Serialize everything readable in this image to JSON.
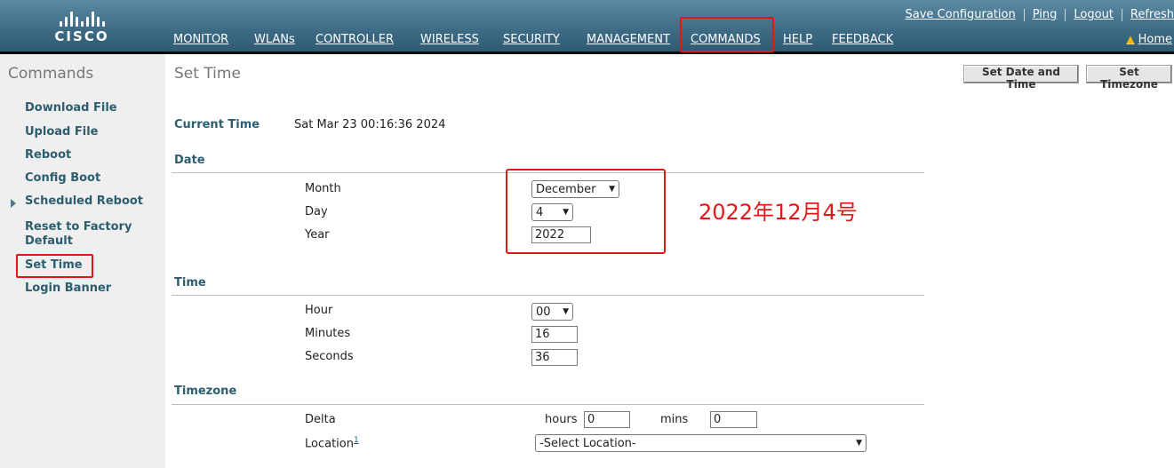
{
  "header": {
    "logo_text": "CISCO",
    "top_links": [
      "Save Configuration",
      "Ping",
      "Logout",
      "Refresh"
    ],
    "nav": [
      "MONITOR",
      "WLANs",
      "CONTROLLER",
      "WIRELESS",
      "SECURITY",
      "MANAGEMENT",
      "COMMANDS",
      "HELP",
      "FEEDBACK"
    ],
    "active_nav": "COMMANDS",
    "home": "Home"
  },
  "sidebar": {
    "title": "Commands",
    "items": [
      "Download File",
      "Upload File",
      "Reboot",
      "Config Boot",
      "Scheduled Reboot",
      "Reset to Factory Default",
      "Set Time",
      "Login Banner"
    ],
    "active": "Set Time"
  },
  "main": {
    "title": "Set Time",
    "buttons": {
      "set_date_time": "Set Date and Time",
      "set_timezone": "Set Timezone"
    },
    "current_time_label": "Current Time",
    "current_time_value": "Sat Mar 23 00:16:36 2024",
    "date": {
      "section": "Date",
      "month_label": "Month",
      "month_value": "December",
      "day_label": "Day",
      "day_value": "4",
      "year_label": "Year",
      "year_value": "2022"
    },
    "time": {
      "section": "Time",
      "hour_label": "Hour",
      "hour_value": "00",
      "minutes_label": "Minutes",
      "minutes_value": "16",
      "seconds_label": "Seconds",
      "seconds_value": "36"
    },
    "timezone": {
      "section": "Timezone",
      "delta_label": "Delta",
      "hours_label": "hours",
      "hours_value": "0",
      "mins_label": "mins",
      "mins_value": "0",
      "location_label": "Location",
      "location_footnote": "1",
      "location_value": "-Select Location-"
    },
    "annotation": "2022年12月4号"
  },
  "colors": {
    "accent_red": "#e01818",
    "label_teal": "#2c5e6f",
    "header_blue": "#3f6c86"
  }
}
